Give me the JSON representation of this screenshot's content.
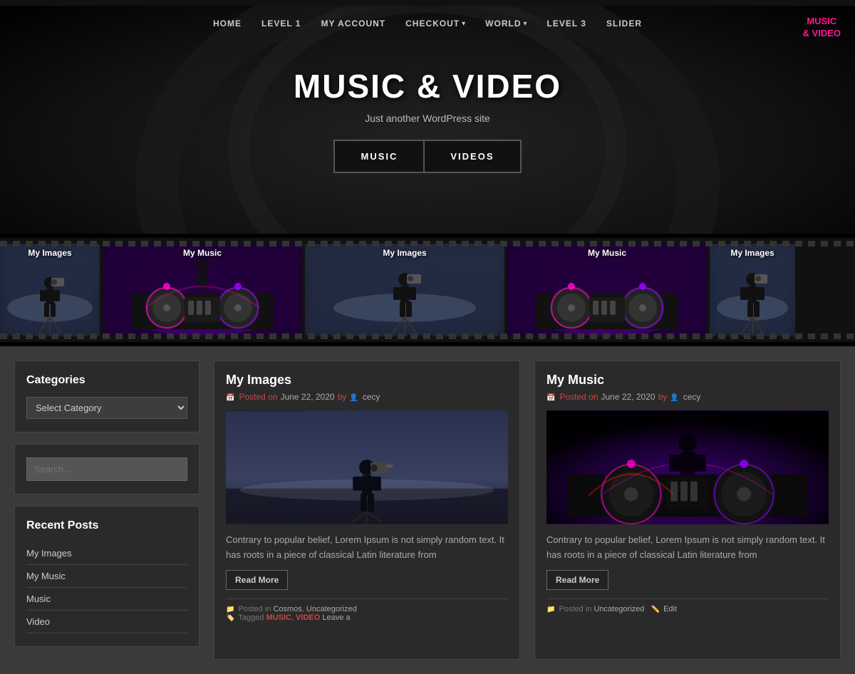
{
  "topBar": {},
  "nav": {
    "links": [
      {
        "label": "HOME",
        "href": "#",
        "hasDropdown": false
      },
      {
        "label": "LEVEL 1",
        "href": "#",
        "hasDropdown": false
      },
      {
        "label": "MY ACCOUNT",
        "href": "#",
        "hasDropdown": false
      },
      {
        "label": "CHECKOUT",
        "href": "#",
        "hasDropdown": true
      },
      {
        "label": "WORLD",
        "href": "#",
        "hasDropdown": true
      },
      {
        "label": "LEVEL 3",
        "href": "#",
        "hasDropdown": false
      },
      {
        "label": "SLIDER",
        "href": "#",
        "hasDropdown": false
      }
    ],
    "logo": {
      "line1": "MUSIC",
      "line2": "& VIDEO"
    }
  },
  "hero": {
    "title": "MUSIC & VIDEO",
    "subtitle": "Just another WordPress site",
    "buttons": [
      {
        "label": "MUSIC"
      },
      {
        "label": "VIDEOS"
      }
    ]
  },
  "filmstrip": {
    "cells": [
      {
        "label": "My Images",
        "type": "camera"
      },
      {
        "label": "My Music",
        "type": "dj"
      },
      {
        "label": "My Images",
        "type": "camera"
      },
      {
        "label": "My Music",
        "type": "dj"
      },
      {
        "label": "My Images",
        "type": "camera"
      }
    ]
  },
  "sidebar": {
    "categoriesTitle": "Categories",
    "categoryPlaceholder": "Select Category",
    "searchPlaceholder": "Search...",
    "recentPostsTitle": "Recent Posts",
    "recentPosts": [
      {
        "label": "My Images"
      },
      {
        "label": "My Music"
      },
      {
        "label": "Music"
      },
      {
        "label": "Video"
      }
    ]
  },
  "posts": [
    {
      "title": "My Images",
      "date": "June 22, 2020",
      "author": "cecy",
      "type": "camera",
      "excerpt": "Contrary to popular belief, Lorem Ipsum is not simply random text. It has roots in a piece of classical Latin literature from",
      "readMore": "Read More",
      "postedIn": "Posted in",
      "categories": [
        "Cosmos",
        "Uncategorized"
      ],
      "tagged": "Tagged",
      "tags": [
        "MUSIC",
        "VIDEO"
      ],
      "leaveComment": "Leave a"
    },
    {
      "title": "My Music",
      "date": "June 22, 2020",
      "author": "cecy",
      "type": "dj",
      "excerpt": "Contrary to popular belief, Lorem Ipsum is not simply random text. It has roots in a piece of classical Latin literature from",
      "readMore": "Read More",
      "postedIn": "Posted in",
      "categories": [
        "Uncategorized"
      ],
      "tagged": "",
      "tags": [],
      "editLabel": "Edit"
    }
  ]
}
